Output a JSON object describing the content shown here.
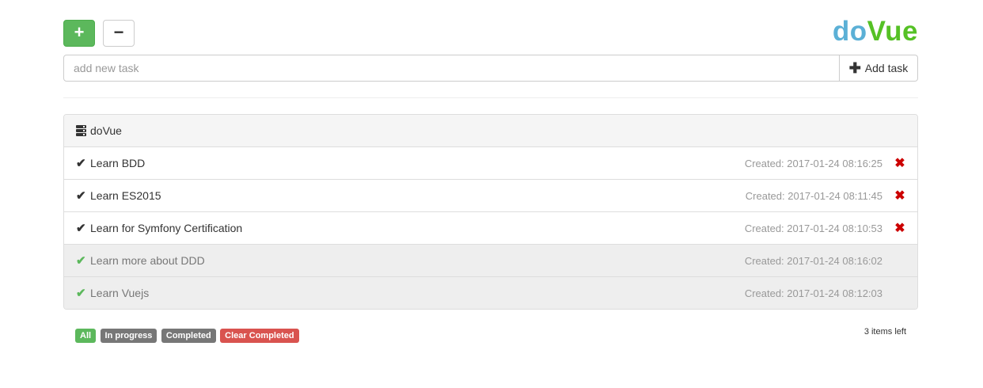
{
  "header": {
    "plus_symbol": "+",
    "minus_symbol": "−",
    "logo_part1": "do",
    "logo_part2": "Vue"
  },
  "new_task": {
    "placeholder": "add new task",
    "value": "",
    "add_button_label": "Add task"
  },
  "panel": {
    "title": "doVue",
    "tasks": [
      {
        "title": "Learn BDD",
        "created": "Created: 2017-01-24 08:16:25",
        "completed": false
      },
      {
        "title": "Learn ES2015",
        "created": "Created: 2017-01-24 08:11:45",
        "completed": false
      },
      {
        "title": "Learn for Symfony Certification",
        "created": "Created: 2017-01-24 08:10:53",
        "completed": false
      },
      {
        "title": "Learn more about DDD",
        "created": "Created: 2017-01-24 08:16:02",
        "completed": true
      },
      {
        "title": "Learn Vuejs",
        "created": "Created: 2017-01-24 08:12:03",
        "completed": true
      }
    ]
  },
  "footer": {
    "filter_all": "All",
    "filter_in_progress": "In progress",
    "filter_completed": "Completed",
    "clear_completed": "Clear Completed",
    "items_left": "3 items left"
  },
  "colors": {
    "success": "#5cb85c",
    "danger": "#d9534f",
    "default": "#777777",
    "logo_blue": "#5bb0d6",
    "logo_green": "#55c125",
    "delete_red": "#cc0000"
  },
  "icons": {
    "check": "check-icon",
    "delete": "remove-icon",
    "panel": "server-icon",
    "plus": "plus-icon"
  }
}
